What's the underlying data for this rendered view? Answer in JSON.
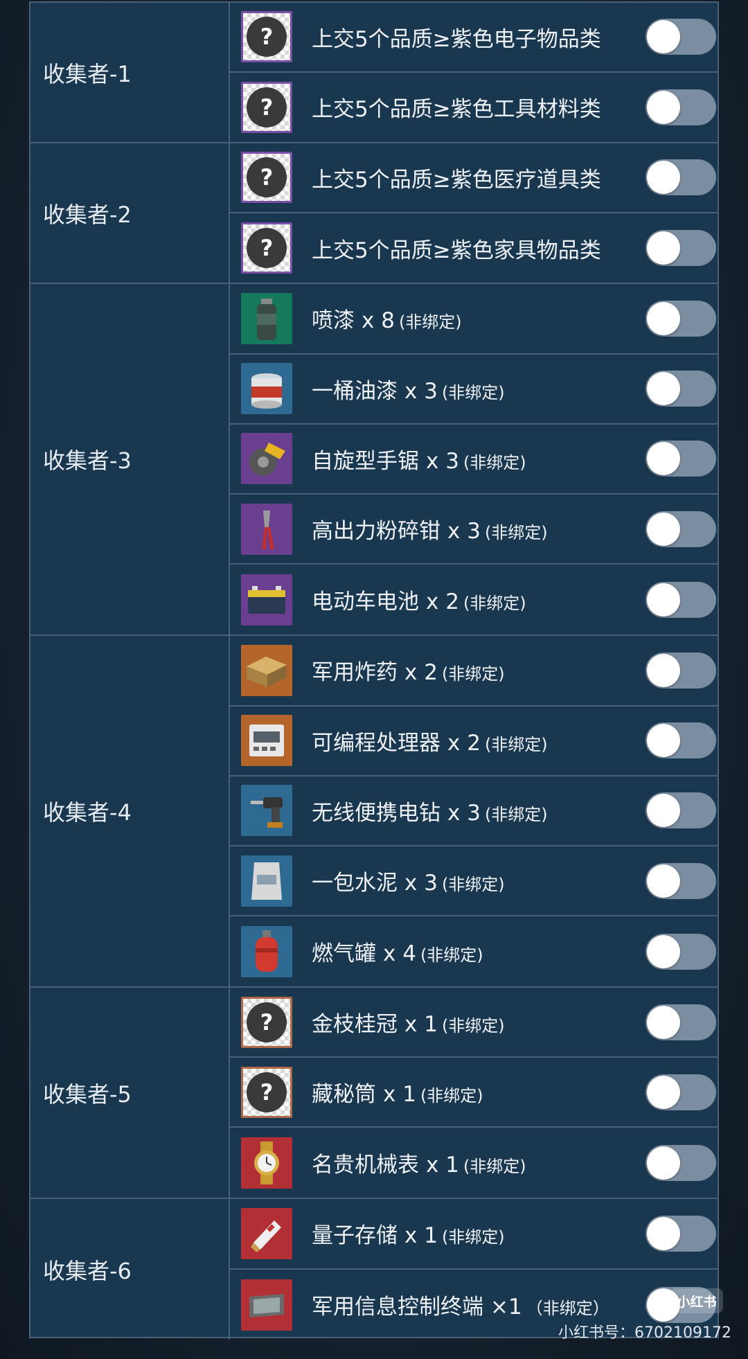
{
  "groups": [
    {
      "label": "收集者-1",
      "items": [
        {
          "name": "上交5个品质≥紫色电子物品类",
          "qty": "",
          "tag": "",
          "icon": "question-mark-icon",
          "icon_border": "#7a4fa6"
        },
        {
          "name": "上交5个品质≥紫色工具材料类",
          "qty": "",
          "tag": "",
          "icon": "question-mark-icon",
          "icon_border": "#7a4fa6"
        }
      ]
    },
    {
      "label": "收集者-2",
      "items": [
        {
          "name": "上交5个品质≥紫色医疗道具类",
          "qty": "",
          "tag": "",
          "icon": "question-mark-icon",
          "icon_border": "#7a4fa6"
        },
        {
          "name": "上交5个品质≥紫色家具物品类",
          "qty": "",
          "tag": "",
          "icon": "question-mark-icon",
          "icon_border": "#7a4fa6"
        }
      ]
    },
    {
      "label": "收集者-3",
      "items": [
        {
          "name": "喷漆",
          "qty": "x 8",
          "tag": "(非绑定)",
          "icon": "spray-paint-icon",
          "icon_bg": "#157a5c"
        },
        {
          "name": "一桶油漆",
          "qty": "x 3",
          "tag": "(非绑定)",
          "icon": "paint-bucket-icon",
          "icon_bg": "#2e6a91"
        },
        {
          "name": "自旋型手锯",
          "qty": "x 3",
          "tag": "(非绑定)",
          "icon": "circular-saw-icon",
          "icon_bg": "#6b3f8f"
        },
        {
          "name": "高出力粉碎钳",
          "qty": "x 3",
          "tag": "(非绑定)",
          "icon": "pliers-icon",
          "icon_bg": "#6b3f8f"
        },
        {
          "name": "电动车电池",
          "qty": "x 2",
          "tag": "(非绑定)",
          "icon": "battery-icon",
          "icon_bg": "#6b3f8f"
        }
      ]
    },
    {
      "label": "收集者-4",
      "items": [
        {
          "name": "军用炸药",
          "qty": "x 2",
          "tag": "(非绑定)",
          "icon": "explosives-crate-icon",
          "icon_bg": "#b4652c"
        },
        {
          "name": "可编程处理器",
          "qty": "x 2",
          "tag": "(非绑定)",
          "icon": "processor-icon",
          "icon_bg": "#b4652c"
        },
        {
          "name": "无线便携电钻",
          "qty": "x 3",
          "tag": "(非绑定)",
          "icon": "drill-icon",
          "icon_bg": "#2e6a91"
        },
        {
          "name": "一包水泥",
          "qty": "x 3",
          "tag": "(非绑定)",
          "icon": "cement-bag-icon",
          "icon_bg": "#2e6a91"
        },
        {
          "name": "燃气罐",
          "qty": "x 4",
          "tag": "(非绑定)",
          "icon": "gas-canister-icon",
          "icon_bg": "#2e6a91"
        }
      ]
    },
    {
      "label": "收集者-5",
      "items": [
        {
          "name": "金枝桂冠",
          "qty": "x 1",
          "tag": "(非绑定)",
          "icon": "question-mark-icon",
          "icon_border": "#b06a4a"
        },
        {
          "name": "藏秘筒",
          "qty": "x 1",
          "tag": "(非绑定)",
          "icon": "question-mark-icon",
          "icon_border": "#b06a4a"
        },
        {
          "name": "名贵机械表",
          "qty": "x 1",
          "tag": "(非绑定)",
          "icon": "watch-icon",
          "icon_bg": "#b12f35"
        }
      ]
    },
    {
      "label": "收集者-6",
      "items": [
        {
          "name": "量子存储",
          "qty": "x 1",
          "tag": "(非绑定)",
          "icon": "quantum-storage-icon",
          "icon_bg": "#b12f35"
        },
        {
          "name": "军用信息控制终端",
          "qty": "×1",
          "tag": "（非绑定）",
          "icon": "control-terminal-icon",
          "icon_bg": "#b12f35"
        }
      ]
    }
  ],
  "watermark": {
    "logo_text": "小红书",
    "id_text": "小红书号：6702109172"
  },
  "colors": {
    "panel_bg": "#1a3750",
    "border": "#4a6179",
    "toggle_track": "#7b8da0",
    "toggle_knob": "#ffffff"
  },
  "toggles_on": false
}
